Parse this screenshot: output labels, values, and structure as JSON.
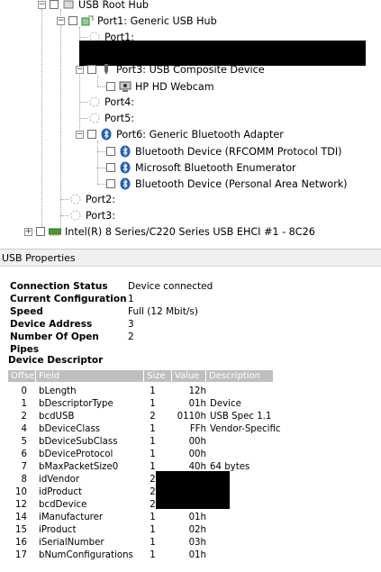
{
  "tree": {
    "root_hub": "USB Root Hub",
    "port1": "Port1: Generic USB Hub",
    "sub_port1": "Port1:",
    "sub_port3": "Port3: USB Composite Device",
    "webcam": "HP HD Webcam",
    "sub_port4": "Port4:",
    "sub_port5": "Port5:",
    "sub_port6": "Port6: Generic Bluetooth Adapter",
    "bt1": "Bluetooth Device (RFCOMM Protocol TDI)",
    "bt2": "Microsoft Bluetooth Enumerator",
    "bt3": "Bluetooth Device (Personal Area Network)",
    "port2": "Port2:",
    "port3": "Port3:",
    "ehci": "Intel(R) 8 Series/C220 Series USB EHCI #1 - 8C26"
  },
  "panel_title": "USB Properties",
  "properties": [
    {
      "label": "Connection Status",
      "value": "Device connected"
    },
    {
      "label": "Current Configuration",
      "value": "1"
    },
    {
      "label": "Speed",
      "value": "Full (12 Mbit/s)"
    },
    {
      "label": "Device Address",
      "value": "3"
    },
    {
      "label": "Number Of Open Pipes",
      "value": "2"
    }
  ],
  "descriptor": {
    "title": "Device Descriptor",
    "headers": [
      "Offset",
      "Field",
      "Size",
      "Value",
      "Description"
    ],
    "rows": [
      [
        "0",
        "bLength",
        "1",
        "12h",
        ""
      ],
      [
        "1",
        "bDescriptorType",
        "1",
        "01h",
        "Device"
      ],
      [
        "2",
        "bcdUSB",
        "2",
        "0110h",
        "USB Spec 1.1"
      ],
      [
        "4",
        "bDeviceClass",
        "1",
        "FFh",
        "Vendor-Specific"
      ],
      [
        "5",
        "bDeviceSubClass",
        "1",
        "00h",
        ""
      ],
      [
        "6",
        "bDeviceProtocol",
        "1",
        "00h",
        ""
      ],
      [
        "7",
        "bMaxPacketSize0",
        "1",
        "40h",
        "64 bytes"
      ],
      [
        "8",
        "idVendor",
        "2",
        "",
        ""
      ],
      [
        "10",
        "idProduct",
        "2",
        "",
        ""
      ],
      [
        "12",
        "bcdDevice",
        "2",
        "",
        ""
      ],
      [
        "14",
        "iManufacturer",
        "1",
        "01h",
        ""
      ],
      [
        "15",
        "iProduct",
        "1",
        "02h",
        ""
      ],
      [
        "16",
        "iSerialNumber",
        "1",
        "03h",
        ""
      ],
      [
        "17",
        "bNumConfigurations",
        "1",
        "01h",
        ""
      ]
    ]
  },
  "colors": {
    "bluetooth": "#1f5fbf",
    "header_gray": "#bfbfbf"
  }
}
